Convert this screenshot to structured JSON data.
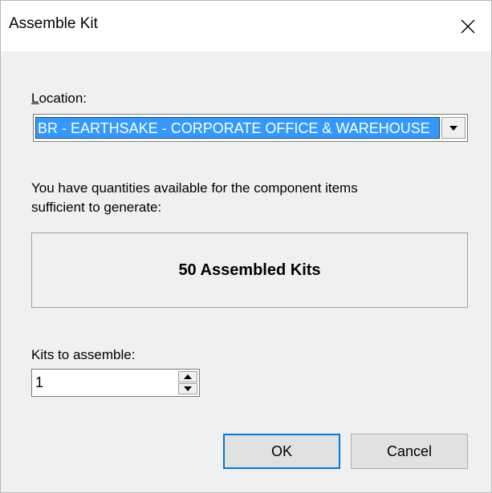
{
  "window": {
    "title": "Assemble Kit"
  },
  "location": {
    "label_accel": "L",
    "label_rest": "ocation:",
    "selected_value": "BR - EARTHSAKE - CORPORATE OFFICE & WAREHOUSE"
  },
  "availability": {
    "line1": "You have quantities available for the component items",
    "line2": "sufficient to generate:",
    "result": "50 Assembled Kits"
  },
  "kits": {
    "label": "Kits to assemble:",
    "value": "1"
  },
  "buttons": {
    "ok": "OK",
    "cancel": "Cancel"
  },
  "icons": {
    "close": "close-icon",
    "dropdown": "chevron-down-icon",
    "spin_up": "triangle-up-icon",
    "spin_down": "triangle-down-icon"
  },
  "colors": {
    "selection": "#3399ff",
    "default_button_border": "#0078d7",
    "client_background": "#f0f0f0"
  }
}
